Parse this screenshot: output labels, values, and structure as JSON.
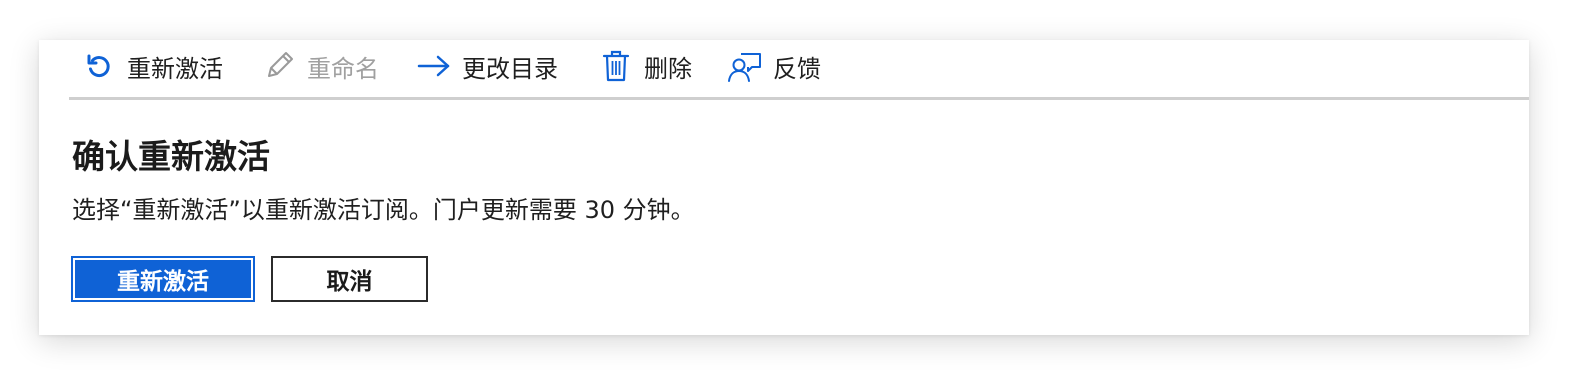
{
  "toolbar": {
    "reactivate_label": "重新激活",
    "rename_label": "重命名",
    "change_directory_label": "更改目录",
    "delete_label": "删除",
    "feedback_label": "反馈"
  },
  "dialog": {
    "title": "确认重新激活",
    "description": "选择“重新激活”以重新激活订阅。门户更新需要 30 分钟。",
    "confirm_button": "重新激活",
    "cancel_button": "取消"
  },
  "icons": {
    "reactivate": "refresh-icon",
    "rename": "pencil-icon",
    "change_directory": "arrow-right-icon",
    "delete": "trash-icon",
    "feedback": "feedback-person-icon"
  },
  "colors": {
    "accent": "#0f62d6",
    "disabled_text": "#a0a0a0",
    "text": "#1f1f1f"
  }
}
